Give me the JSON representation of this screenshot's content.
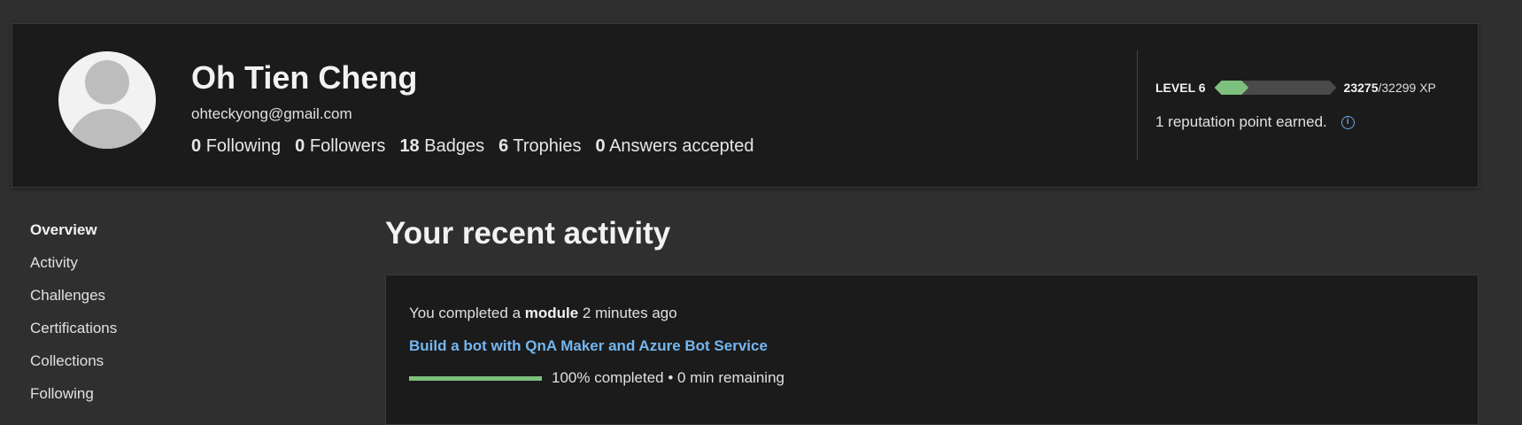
{
  "profile": {
    "name": "Oh Tien Cheng",
    "email": "ohteckyong@gmail.com",
    "stats": [
      {
        "count": "0",
        "label": "Following"
      },
      {
        "count": "0",
        "label": "Followers"
      },
      {
        "count": "18",
        "label": "Badges"
      },
      {
        "count": "6",
        "label": "Trophies"
      },
      {
        "count": "0",
        "label": "Answers accepted"
      }
    ]
  },
  "level": {
    "label": "LEVEL 6",
    "xp_current": "23275",
    "xp_total": "/32299 XP",
    "progress_fraction": 0.28,
    "reputation": "1 reputation point earned."
  },
  "sidebar": {
    "items": [
      {
        "label": "Overview"
      },
      {
        "label": "Activity"
      },
      {
        "label": "Challenges"
      },
      {
        "label": "Certifications"
      },
      {
        "label": "Collections"
      },
      {
        "label": "Following"
      }
    ]
  },
  "main": {
    "title": "Your recent activity",
    "activity": {
      "prefix": "You completed a ",
      "type": "module",
      "time": " 2 minutes ago",
      "link": "Build a bot with QnA Maker and Azure Bot Service",
      "progress_percent": 100,
      "progress_text": "100% completed • 0 min remaining"
    }
  },
  "colors": {
    "accent_green": "#7ec07e",
    "link_blue": "#75b6f0",
    "card_bg": "#1b1b1b",
    "page_bg": "#2f2f2f"
  }
}
